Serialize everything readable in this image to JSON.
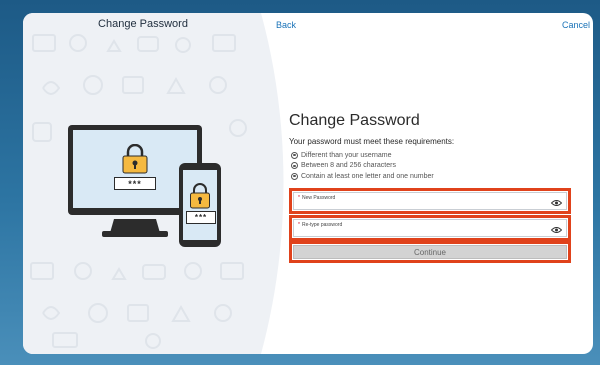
{
  "header": {
    "left_title": "Change Password",
    "back_label": "Back",
    "cancel_label": "Cancel"
  },
  "form": {
    "title": "Change Password",
    "requirements_intro": "Your password must meet these requirements:",
    "requirements": [
      "Different than your username",
      "Between 8 and 256 characters",
      "Contain at least one letter and one number"
    ],
    "new_password": {
      "label": "New Password",
      "required_mark": "*",
      "value": ""
    },
    "retype_password": {
      "label": "Re-type password",
      "required_mark": "*",
      "value": ""
    },
    "continue_label": "Continue"
  },
  "illustration": {
    "monitor_mask": "***",
    "phone_mask": "***",
    "icons": [
      "monitor-icon",
      "phone-icon",
      "padlock-icon",
      "eye-icon"
    ]
  },
  "colors": {
    "background_top": "#1d5a86",
    "link": "#1a73b8",
    "highlight": "#e0421b",
    "lock": "#f5b940",
    "screen": "#d9e9f5"
  }
}
